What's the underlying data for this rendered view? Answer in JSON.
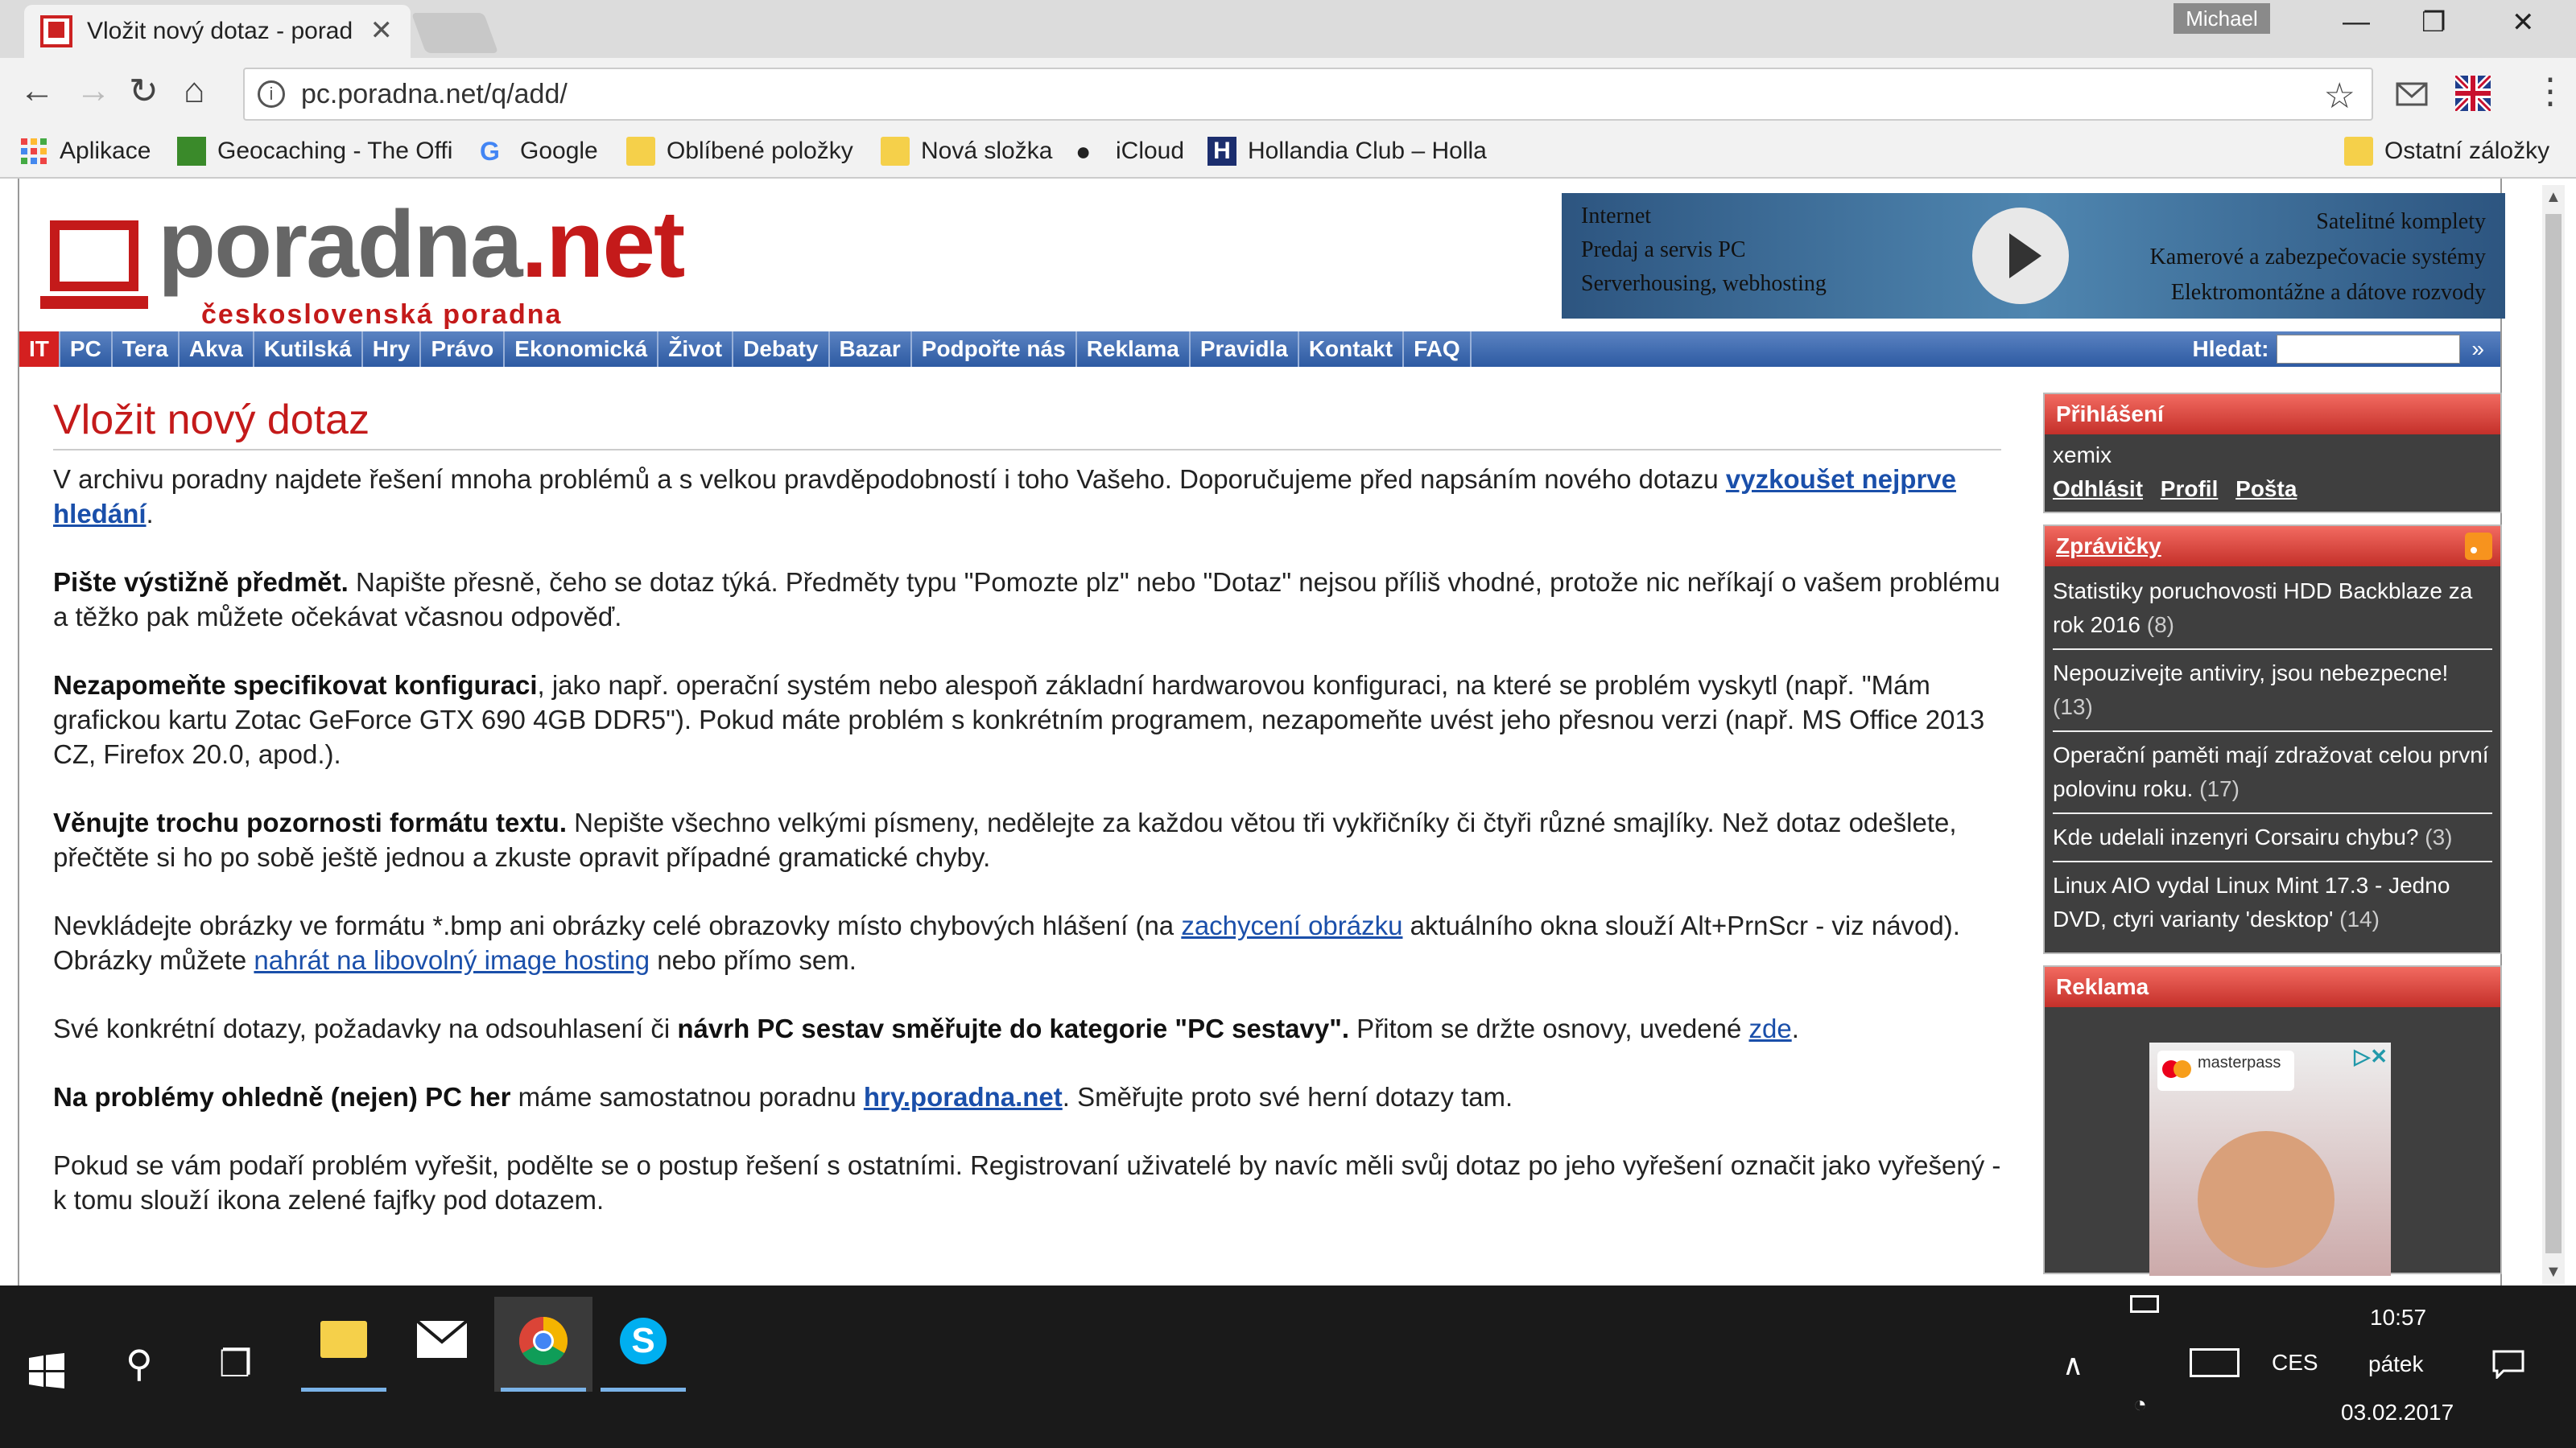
{
  "browser": {
    "tab_title": "Vložit nový dotaz - porad",
    "tab_close": "✕",
    "user": "Michael",
    "url": "pc.poradna.net/q/add/",
    "bookmarks": [
      {
        "label": "Aplikace"
      },
      {
        "label": "Geocaching - The Offi"
      },
      {
        "label": "Google"
      },
      {
        "label": "Oblíbené položky"
      },
      {
        "label": "Nová složka"
      },
      {
        "label": "iCloud"
      },
      {
        "label": "Hollandia Club – Holla"
      }
    ],
    "other_bookmarks": "Ostatní záložky"
  },
  "site": {
    "logo_main_gray": "poradna",
    "logo_main_red": ".net",
    "logo_sub": "československá poradna",
    "banner_left": [
      "Internet",
      "Predaj a servis PC",
      "Serverhousing, webhosting"
    ],
    "banner_right": [
      "Satelitné komplety",
      "Kamerové a zabezpečovacie systémy",
      "Elektromontážne a dátove rozvody"
    ],
    "menu": [
      "IT",
      "PC",
      "Tera",
      "Akva",
      "Kutilská",
      "Hry",
      "Právo",
      "Ekonomická",
      "Život",
      "Debaty",
      "Bazar",
      "Podpořte nás",
      "Reklama",
      "Pravidla",
      "Kontakt",
      "FAQ"
    ],
    "search_label": "Hledat:",
    "search_go": "»"
  },
  "content": {
    "title": "Vložit nový dotaz",
    "p1_text": "V archivu poradny najdete řešení mnoha problémů a s velkou pravděpodobností i toho Vašeho. Doporučujeme před napsáním nového dotazu ",
    "p1_link": "vyzkoušet nejprve hledání",
    "p1_end": ".",
    "p2_bold": "Pište výstižně předmět.",
    "p2_text": " Napište přesně, čeho se dotaz týká. Předměty typu \"Pomozte plz\" nebo \"Dotaz\" nejsou příliš vhodné, protože nic neříkají o vašem problému a těžko pak můžete očekávat včasnou odpověď.",
    "p3_bold": "Nezapomeňte specifikovat konfiguraci",
    "p3_text": ", jako např. operační systém nebo alespoň základní hardwarovou konfiguraci, na které se problém vyskytl (např. \"Mám grafickou kartu Zotac GeForce GTX 690 4GB DDR5\"). Pokud máte problém s konkrétním programem, nezapomeňte uvést jeho přesnou verzi (např. MS Office 2013 CZ, Firefox 20.0, apod.).",
    "p4_bold": "Věnujte trochu pozornosti formátu textu.",
    "p4_text": " Nepište všechno velkými písmeny, nedělejte za každou větou tři vykřičníky či čtyři různé smajlíky. Než dotaz odešlete, přečtěte si ho po sobě ještě jednou a zkuste opravit případné gramatické chyby.",
    "p5_a": "Nevkládejte obrázky ve formátu *.bmp ani obrázky celé obrazovky místo chybových hlášení (na ",
    "p5_link1": "zachycení obrázku",
    "p5_b": " aktuálního okna slouží Alt+PrnScr - viz návod). Obrázky můžete ",
    "p5_link2": "nahrát na libovolný image hosting",
    "p5_c": " nebo přímo sem.",
    "p6_a": "Své konkrétní dotazy, požadavky na odsouhlasení či ",
    "p6_bold": "návrh PC sestav směřujte do kategorie \"PC sestavy\".",
    "p6_b": " Přitom se držte osnovy, uvedené ",
    "p6_link": "zde",
    "p6_end": ".",
    "p7_bold": "Na problémy ohledně (nejen) PC her",
    "p7_a": " máme samostatnou poradnu ",
    "p7_link": "hry.poradna.net",
    "p7_b": ". Směřujte proto své herní dotazy tam.",
    "p8_text": "Pokud se vám podaří problém vyřešit, podělte se o postup řešení s ostatními. Registrovaní uživatelé by navíc měli svůj dotaz po jeho vyřešení označit jako vyřešený - k tomu slouží ikona zelené fajfky pod dotazem."
  },
  "sidebar": {
    "login_title": "Přihlášení",
    "username": "xemix",
    "login_links": [
      "Odhlásit",
      "Profil",
      "Pošta"
    ],
    "news_title": "Zprávičky",
    "news": [
      {
        "title": "Statistiky poruchovosti HDD Backblaze za rok 2016",
        "count": "(8)"
      },
      {
        "title": "Nepouzivejte antiviry, jsou nebezpecne!",
        "count": "(13)"
      },
      {
        "title": "Operační paměti mají zdražovat celou první polovinu roku.",
        "count": "(17)"
      },
      {
        "title": "Kde udelali inzenyri Corsairu chybu?",
        "count": "(3)"
      },
      {
        "title": "Linux AIO vydal Linux Mint 17.3 - Jedno DVD, ctyri varianty 'desktop'",
        "count": "(14)"
      }
    ],
    "ad_title": "Reklama",
    "ad_brand": "masterpass"
  },
  "taskbar": {
    "time": "10:57",
    "day": "pátek",
    "date": "03.02.2017",
    "lang": "CES"
  },
  "colors": {
    "accent_red": "#c41a1a",
    "menu_blue": "#2d5aa2",
    "taskbar": "#1a1a1a"
  }
}
